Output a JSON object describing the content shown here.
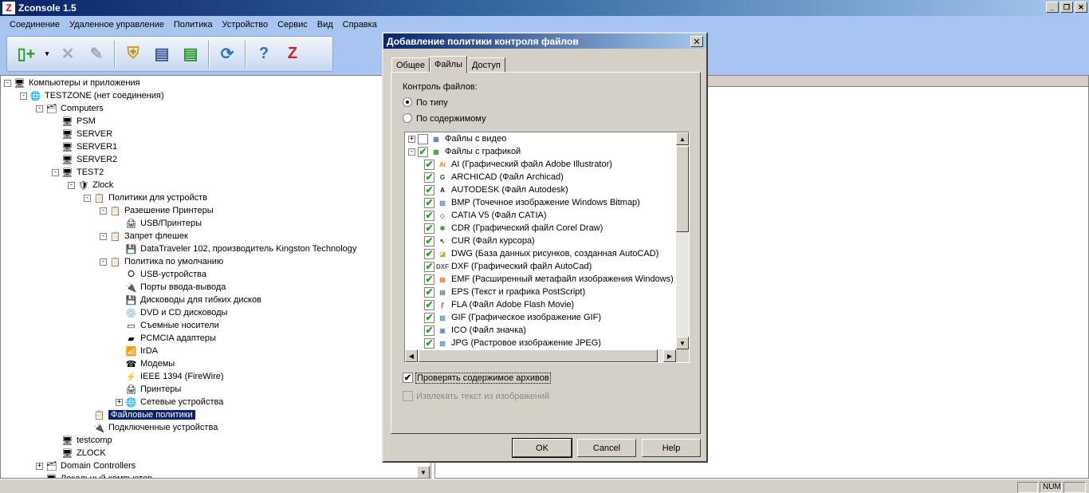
{
  "app": {
    "title": "Zconsole 1.5",
    "logo": "Z"
  },
  "menu": [
    "Соединение",
    "Удаленное управление",
    "Политика",
    "Устройство",
    "Сервис",
    "Вид",
    "Справка"
  ],
  "tree": [
    {
      "text": "Компьютеры и приложения",
      "level": 0,
      "pm": "-",
      "icon": "computer-apps-icon",
      "glyph": "🖥"
    },
    {
      "text": "TESTZONE (нет соединения)",
      "level": 1,
      "pm": "-",
      "icon": "globe-icon",
      "glyph": "🌐"
    },
    {
      "text": "Computers",
      "level": 2,
      "pm": "-",
      "icon": "computers-group-icon",
      "glyph": "🗂"
    },
    {
      "text": "PSM",
      "level": 3,
      "pm": "",
      "icon": "computer-icon",
      "glyph": "🖥"
    },
    {
      "text": "SERVER",
      "level": 3,
      "pm": "",
      "icon": "computer-icon",
      "glyph": "🖥"
    },
    {
      "text": "SERVER1",
      "level": 3,
      "pm": "",
      "icon": "computer-icon",
      "glyph": "🖥"
    },
    {
      "text": "SERVER2",
      "level": 3,
      "pm": "",
      "icon": "computer-icon",
      "glyph": "🖥"
    },
    {
      "text": "TEST2",
      "level": 3,
      "pm": "-",
      "icon": "computer-icon",
      "glyph": "🖥"
    },
    {
      "text": "Zlock",
      "level": 4,
      "pm": "-",
      "icon": "zlock-icon",
      "glyph": "🛡"
    },
    {
      "text": "Политики для устройств",
      "level": 5,
      "pm": "-",
      "icon": "policy-folder-icon",
      "glyph": "📋"
    },
    {
      "text": "Разешение Принтеры",
      "level": 6,
      "pm": "-",
      "icon": "allow-policy-icon",
      "glyph": "📋"
    },
    {
      "text": "USB/Принтеры",
      "level": 7,
      "pm": "",
      "icon": "printer-icon",
      "glyph": "🖨"
    },
    {
      "text": "Запрет флешек",
      "level": 6,
      "pm": "-",
      "icon": "deny-policy-icon",
      "glyph": "📋"
    },
    {
      "text": "DataTraveler 102, производитель Kingston Technology",
      "level": 7,
      "pm": "",
      "icon": "usb-drive-icon",
      "glyph": "💾"
    },
    {
      "text": "Политика по умолчанию",
      "level": 6,
      "pm": "-",
      "icon": "default-policy-icon",
      "glyph": "📋"
    },
    {
      "text": "USB-устройства",
      "level": 7,
      "pm": "",
      "icon": "usb-icon",
      "glyph": "⭘"
    },
    {
      "text": "Порты ввода-вывода",
      "level": 7,
      "pm": "",
      "icon": "port-icon",
      "glyph": "🔌"
    },
    {
      "text": "Дисководы для гибких дисков",
      "level": 7,
      "pm": "",
      "icon": "floppy-icon",
      "glyph": "💾"
    },
    {
      "text": "DVD и CD дисководы",
      "level": 7,
      "pm": "",
      "icon": "cd-icon",
      "glyph": "💿"
    },
    {
      "text": "Съемные носители",
      "level": 7,
      "pm": "",
      "icon": "removable-drive-icon",
      "glyph": "▭"
    },
    {
      "text": "PCMCIA адаптеры",
      "level": 7,
      "pm": "",
      "icon": "pcmcia-icon",
      "glyph": "▰"
    },
    {
      "text": "IrDA",
      "level": 7,
      "pm": "",
      "icon": "irda-icon",
      "glyph": "📶"
    },
    {
      "text": "Модемы",
      "level": 7,
      "pm": "",
      "icon": "modem-icon",
      "glyph": "☎"
    },
    {
      "text": "IEEE 1394 (FireWire)",
      "level": 7,
      "pm": "",
      "icon": "firewire-icon",
      "glyph": "⚡"
    },
    {
      "text": "Принтеры",
      "level": 7,
      "pm": "",
      "icon": "printer-icon",
      "glyph": "🖨"
    },
    {
      "text": "Сетевые устройства",
      "level": 7,
      "pm": "+",
      "icon": "network-icon",
      "glyph": "🌐"
    },
    {
      "text": "Файловые политики",
      "level": 5,
      "pm": "",
      "icon": "file-policy-icon",
      "glyph": "📋",
      "selected": true
    },
    {
      "text": "Подключенные устройства",
      "level": 5,
      "pm": "",
      "icon": "connected-devices-icon",
      "glyph": "🔌"
    },
    {
      "text": "testcomp",
      "level": 3,
      "pm": "",
      "icon": "computer-icon",
      "glyph": "🖥"
    },
    {
      "text": "ZLOCK",
      "level": 3,
      "pm": "",
      "icon": "computer-icon",
      "glyph": "🖥"
    },
    {
      "text": "Domain Controllers",
      "level": 2,
      "pm": "+",
      "icon": "computers-group-icon",
      "glyph": "🗂"
    },
    {
      "text": "Локальный компьютер",
      "level": 2,
      "pm": "",
      "icon": "computer-icon",
      "glyph": "🖥"
    }
  ],
  "status": {
    "num": "NUM"
  },
  "dialog": {
    "title": "Добавление политики контроля файлов",
    "tabs": [
      "Общее",
      "Файлы",
      "Доступ"
    ],
    "active_tab": 1,
    "group_label": "Контроль файлов:",
    "radio_by_type": "По типу",
    "radio_by_content": "По содержимому",
    "file_types": [
      {
        "text": "Файлы с видео",
        "level": 0,
        "pm": "+",
        "checked": false,
        "icon": "video-files-icon",
        "badge": "▦",
        "color": "#5b7fb8"
      },
      {
        "text": "Файлы с графикой",
        "level": 0,
        "pm": "-",
        "checked": true,
        "icon": "graphics-files-icon",
        "badge": "▦",
        "color": "#4a9a4a"
      },
      {
        "text": "AI (Графический файл Adobe Illustrator)",
        "level": 1,
        "pm": "",
        "checked": true,
        "icon": "ai-icon",
        "badge": "Ai",
        "color": "#e07a10"
      },
      {
        "text": "ARCHICAD (Файл Archicad)",
        "level": 1,
        "pm": "",
        "checked": true,
        "icon": "archicad-icon",
        "badge": "G",
        "color": "#2a3a55"
      },
      {
        "text": "AUTODESK (Файл Autodesk)",
        "level": 1,
        "pm": "",
        "checked": true,
        "icon": "autodesk-icon",
        "badge": "A",
        "color": "#111111"
      },
      {
        "text": "BMP (Точечное изображение Windows Bitmap)",
        "level": 1,
        "pm": "",
        "checked": true,
        "icon": "bmp-icon",
        "badge": "▨",
        "color": "#5a8fd0"
      },
      {
        "text": "CATIA V5 (Файл CATIA)",
        "level": 1,
        "pm": "",
        "checked": true,
        "icon": "catia-icon",
        "badge": "◇",
        "color": "#6a8ab0"
      },
      {
        "text": "CDR (Графический файл Corel Draw)",
        "level": 1,
        "pm": "",
        "checked": true,
        "icon": "cdr-icon",
        "badge": "✱",
        "color": "#3a9a3a"
      },
      {
        "text": "CUR (Файл курсора)",
        "level": 1,
        "pm": "",
        "checked": true,
        "icon": "cursor-icon",
        "badge": "↖",
        "color": "#333333"
      },
      {
        "text": "DWG (База данных рисунков, созданная AutoCAD)",
        "level": 1,
        "pm": "",
        "checked": true,
        "icon": "dwg-icon",
        "badge": "◪",
        "color": "#c9a020"
      },
      {
        "text": "DXF (Графический файл AutoCad)",
        "level": 1,
        "pm": "",
        "checked": true,
        "icon": "dxf-icon",
        "badge": "DXF",
        "color": "#555555"
      },
      {
        "text": "EMF (Расширенный метафайл изображения Windows)",
        "level": 1,
        "pm": "",
        "checked": true,
        "icon": "emf-icon",
        "badge": "▤",
        "color": "#e08020"
      },
      {
        "text": "EPS (Текст и графика PostScript)",
        "level": 1,
        "pm": "",
        "checked": true,
        "icon": "eps-icon",
        "badge": "▤",
        "color": "#777777"
      },
      {
        "text": "FLA (Файл Adobe Flash Movie)",
        "level": 1,
        "pm": "",
        "checked": true,
        "icon": "fla-icon",
        "badge": "ƒ",
        "color": "#d03020"
      },
      {
        "text": "GIF (Графическое изображение GIF)",
        "level": 1,
        "pm": "",
        "checked": true,
        "icon": "gif-icon",
        "badge": "▨",
        "color": "#5a8fd0"
      },
      {
        "text": "ICO (Файл значка)",
        "level": 1,
        "pm": "",
        "checked": true,
        "icon": "ico-icon",
        "badge": "▣",
        "color": "#5a8fd0"
      },
      {
        "text": "JPG (Растровое изображение JPEG)",
        "level": 1,
        "pm": "",
        "checked": true,
        "icon": "jpg-icon",
        "badge": "▨",
        "color": "#5a8fd0"
      }
    ],
    "check_archives": "Проверять содержимое архивов",
    "extract_text": "Извлекать текст из изображений",
    "buttons": {
      "ok": "OK",
      "cancel": "Cancel",
      "help": "Help"
    }
  }
}
